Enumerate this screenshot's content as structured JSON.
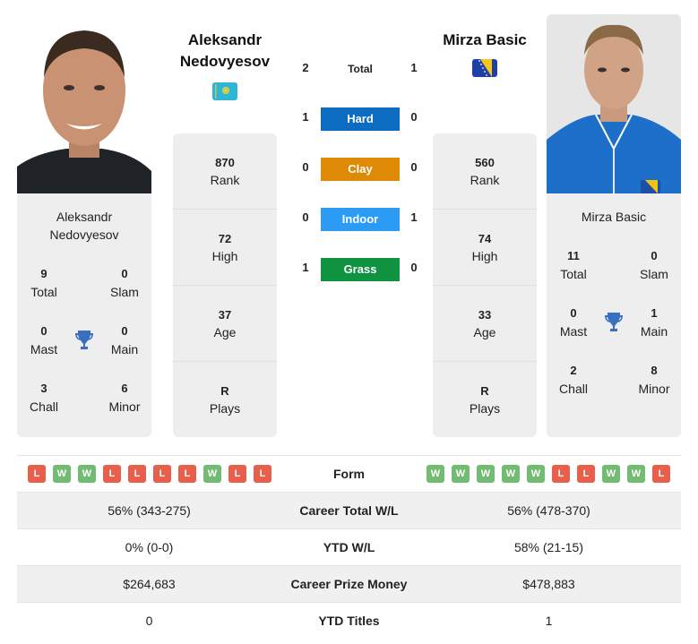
{
  "players": {
    "left": {
      "name": "Aleksandr Nedovyesov",
      "name_line1": "Aleksandr",
      "name_line2": "Nedovyesov",
      "country_flag": "kazakhstan-flag",
      "stats": [
        {
          "value": "870",
          "label": "Rank"
        },
        {
          "value": "72",
          "label": "High"
        },
        {
          "value": "37",
          "label": "Age"
        },
        {
          "value": "R",
          "label": "Plays"
        }
      ],
      "titles": {
        "total": {
          "value": "9",
          "label": "Total"
        },
        "slam": {
          "value": "0",
          "label": "Slam"
        },
        "mast": {
          "value": "0",
          "label": "Mast"
        },
        "main": {
          "value": "0",
          "label": "Main"
        },
        "chall": {
          "value": "3",
          "label": "Chall"
        },
        "minor": {
          "value": "6",
          "label": "Minor"
        }
      },
      "form": [
        "L",
        "W",
        "W",
        "L",
        "L",
        "L",
        "L",
        "W",
        "L",
        "L"
      ]
    },
    "right": {
      "name": "Mirza Basic",
      "country_flag": "bosnia-herzegovina-flag",
      "stats": [
        {
          "value": "560",
          "label": "Rank"
        },
        {
          "value": "74",
          "label": "High"
        },
        {
          "value": "33",
          "label": "Age"
        },
        {
          "value": "R",
          "label": "Plays"
        }
      ],
      "titles": {
        "total": {
          "value": "11",
          "label": "Total"
        },
        "slam": {
          "value": "0",
          "label": "Slam"
        },
        "mast": {
          "value": "0",
          "label": "Mast"
        },
        "main": {
          "value": "1",
          "label": "Main"
        },
        "chall": {
          "value": "2",
          "label": "Chall"
        },
        "minor": {
          "value": "8",
          "label": "Minor"
        }
      },
      "form": [
        "W",
        "W",
        "W",
        "W",
        "W",
        "L",
        "L",
        "W",
        "W",
        "L"
      ]
    }
  },
  "h2h": {
    "total": {
      "label": "Total",
      "left": "2",
      "right": "1"
    },
    "surfaces": [
      {
        "label": "Hard",
        "left": "1",
        "right": "0",
        "color": "#0b6cc2"
      },
      {
        "label": "Clay",
        "left": "0",
        "right": "0",
        "color": "#de8a07"
      },
      {
        "label": "Indoor",
        "left": "0",
        "right": "1",
        "color": "#2b9bf4"
      },
      {
        "label": "Grass",
        "left": "1",
        "right": "0",
        "color": "#0f9341"
      }
    ]
  },
  "comparison": {
    "form_label": "Form",
    "rows": [
      {
        "label": "Career Total W/L",
        "left": "56% (343-275)",
        "right": "56% (478-370)"
      },
      {
        "label": "YTD W/L",
        "left": "0% (0-0)",
        "right": "58% (21-15)"
      },
      {
        "label": "Career Prize Money",
        "left": "$264,683",
        "right": "$478,883"
      },
      {
        "label": "YTD Titles",
        "left": "0",
        "right": "1"
      }
    ]
  },
  "colors": {
    "win": "#72bb72",
    "loss": "#e8604c",
    "trophy": "#3a6fc0",
    "card_bg": "#eeeeee"
  }
}
